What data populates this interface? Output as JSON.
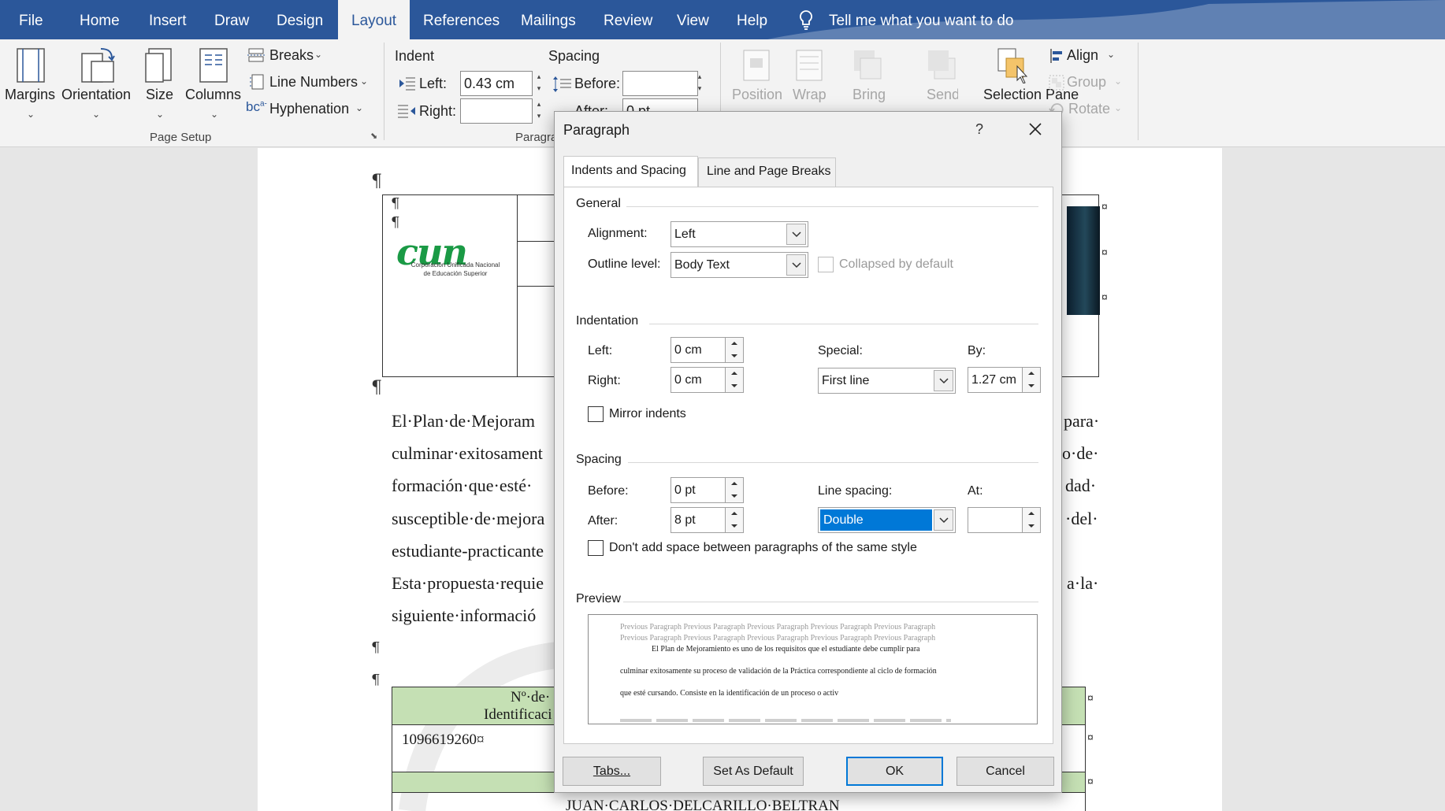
{
  "menubar": {
    "tabs": [
      "File",
      "Home",
      "Insert",
      "Draw",
      "Design",
      "Layout",
      "References",
      "Mailings",
      "Review",
      "View",
      "Help"
    ],
    "active_tab": "Layout",
    "tell_me": "Tell me what you want to do"
  },
  "ribbon": {
    "page_setup": {
      "margins": "Margins",
      "orientation": "Orientation",
      "size": "Size",
      "columns": "Columns",
      "breaks": "Breaks",
      "line_numbers": "Line Numbers",
      "hyphenation": "Hyphenation",
      "title": "Page Setup"
    },
    "paragraph": {
      "indent_title": "Indent",
      "spacing_title": "Spacing",
      "left_label": "Left:",
      "left_value": "0.43 cm",
      "right_label": "Right:",
      "right_value": "",
      "before_label": "Before:",
      "before_value": "",
      "after_label": "After:",
      "after_value": "0 pt",
      "title": "Paragraph"
    },
    "arrange": {
      "position": "Position",
      "wrap": "Wrap Text",
      "bring": "Bring Forward",
      "send": "Send Backward",
      "selection": "Selection Pane",
      "align": "Align",
      "group": "Group",
      "rotate": "Rotate"
    }
  },
  "document": {
    "logo_text": "cun",
    "logo_caption_1": "Corporación Unificada Nacional",
    "logo_caption_2": "de Educación Superior",
    "body_lines": [
      "El·Plan·de·Mejoram",
      "culminar·exitosament",
      "formación·que·esté·",
      "susceptible·de·mejora",
      "estudiante-practicante",
      "Esta·propuesta·requie",
      "siguiente·informació"
    ],
    "right_fragments": [
      "para·",
      "o·de·",
      "dad·",
      "·del·",
      "",
      "a·la·",
      ""
    ],
    "table_header_1": "Nº·de·",
    "table_header_2": "Identificaci",
    "table_id": "1096619260¤",
    "bottom_name": "JUAN·CARLOS·DELCARILLO·BELTRAN"
  },
  "dialog": {
    "title": "Paragraph",
    "help": "?",
    "tabs": [
      "Indents and Spacing",
      "Line and Page Breaks"
    ],
    "general": {
      "title": "General",
      "alignment_label": "Alignment:",
      "alignment_value": "Left",
      "outline_label": "Outline level:",
      "outline_value": "Body Text",
      "collapsed_label": "Collapsed by default"
    },
    "indentation": {
      "title": "Indentation",
      "left_label": "Left:",
      "left_value": "0 cm",
      "right_label": "Right:",
      "right_value": "0 cm",
      "special_label": "Special:",
      "special_value": "First line",
      "by_label": "By:",
      "by_value": "1.27 cm",
      "mirror_label": "Mirror indents"
    },
    "spacing": {
      "title": "Spacing",
      "before_label": "Before:",
      "before_value": "0 pt",
      "after_label": "After:",
      "after_value": "8 pt",
      "line_label": "Line spacing:",
      "line_value": "Double",
      "at_label": "At:",
      "at_value": "",
      "dont_add_label": "Don't add space between paragraphs of the same style"
    },
    "preview": {
      "title": "Preview",
      "prev_line_1": "Previous Paragraph Previous Paragraph Previous Paragraph Previous Paragraph Previous Paragraph",
      "prev_line_2": "Previous Paragraph Previous Paragraph Previous Paragraph Previous Paragraph Previous Paragraph",
      "sample_1": "El Plan de Mejoramiento es uno de los requisitos que el estudiante debe cumplir para",
      "sample_2": "culminar exitosamente su proceso de validación de la Práctica correspondiente al ciclo de formación",
      "sample_3": "que esté cursando. Consiste en la identificación de un proceso o activ"
    },
    "buttons": {
      "tabs": "Tabs...",
      "set_default": "Set As Default",
      "ok": "OK",
      "cancel": "Cancel"
    }
  },
  "colors": {
    "brand": "#2b579a",
    "table_header": "#c5e0b4",
    "selection": "#0078d7"
  }
}
